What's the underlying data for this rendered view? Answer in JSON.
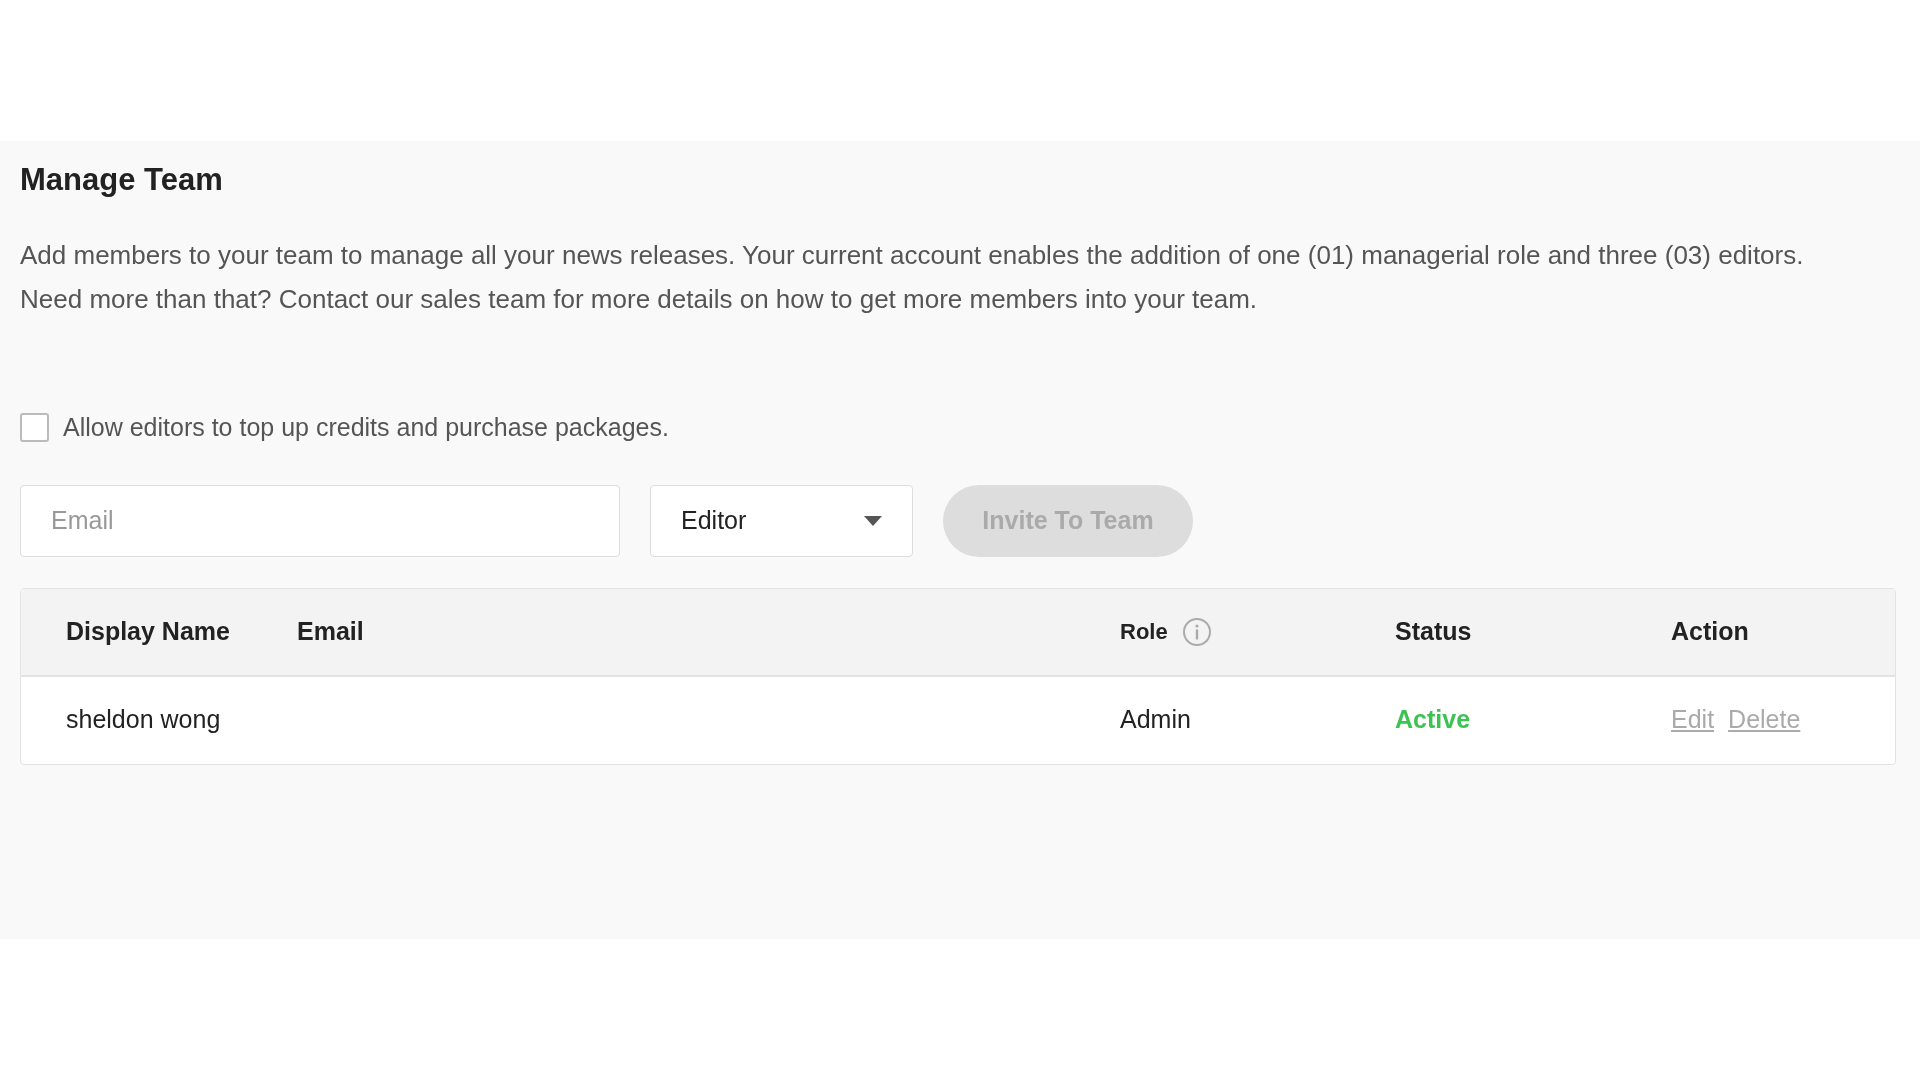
{
  "title": "Manage Team",
  "description": "Add members to your team to manage all your news releases. Your current account enables the addition of one (01) managerial role and three (03) editors. Need more than that? Contact our sales team for more details on how to get more members into your team.",
  "permission": {
    "label": "Allow editors to top up credits and purchase packages.",
    "checked": false
  },
  "invite": {
    "email_placeholder": "Email",
    "role": "Editor",
    "button": {
      "label": "Invite To Team",
      "disabled": true
    }
  },
  "table": {
    "columns": [
      "Display Name",
      "Email",
      "Role",
      "Status",
      "Action"
    ],
    "rows": [
      {
        "display_name": "sheldon wong",
        "email": "",
        "role": "Admin",
        "status": "Active",
        "actions": [
          "Edit",
          "Delete"
        ]
      }
    ]
  }
}
